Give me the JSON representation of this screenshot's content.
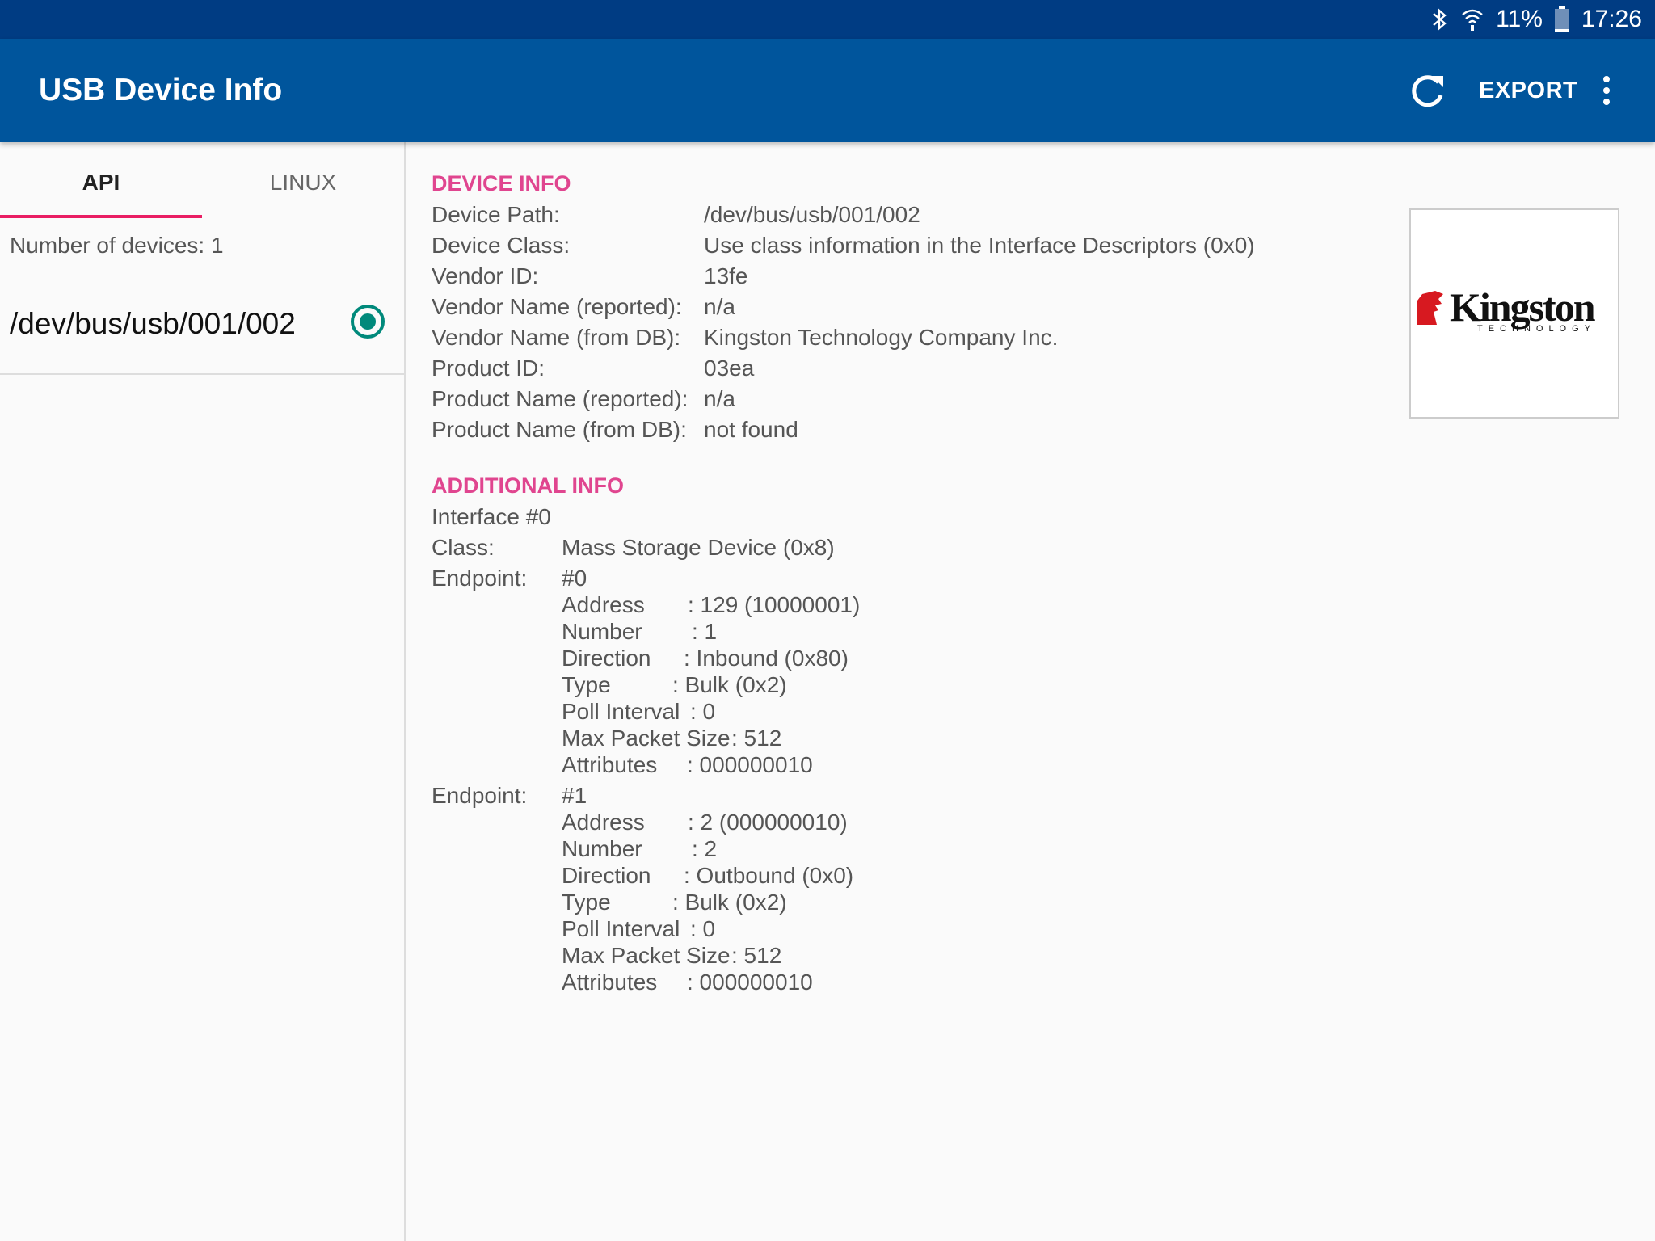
{
  "status_bar": {
    "battery_percent": "11%",
    "time": "17:26",
    "icons": [
      "bluetooth-icon",
      "wifi-icon",
      "battery-icon"
    ]
  },
  "app_bar": {
    "title": "USB Device Info",
    "export_label": "EXPORT",
    "icons": [
      "refresh-icon",
      "more-vert-icon"
    ]
  },
  "tabs": [
    {
      "label": "API",
      "selected": true
    },
    {
      "label": "LINUX",
      "selected": false
    }
  ],
  "device_list": {
    "count_text": "Number of devices: 1",
    "devices": [
      {
        "path": "/dev/bus/usb/001/002",
        "selected": true
      }
    ]
  },
  "device_info": {
    "header": "DEVICE INFO",
    "rows": [
      {
        "label": "Device Path:",
        "value": "/dev/bus/usb/001/002"
      },
      {
        "label": "Device Class:",
        "value": "Use class information in the Interface Descriptors (0x0)"
      },
      {
        "label": "Vendor ID:",
        "value": "13fe"
      },
      {
        "label": "Vendor Name (reported):",
        "value": "n/a"
      },
      {
        "label": "Vendor Name (from DB):",
        "value": "Kingston Technology Company Inc."
      },
      {
        "label": "Product ID:",
        "value": "03ea"
      },
      {
        "label": "Product Name (reported):",
        "value": "n/a"
      },
      {
        "label": "Product Name (from DB):",
        "value": "not found"
      }
    ]
  },
  "logo": {
    "brand": "Kingston",
    "sub": "TECHNOLOGY",
    "colors": {
      "red": "#d71920",
      "black": "#111111"
    }
  },
  "additional_info": {
    "header": "ADDITIONAL INFO",
    "interface": "Interface #0",
    "class_label": "Class:",
    "class_value": "Mass Storage Device (0x8)",
    "endpoints": [
      {
        "label": "Endpoint:",
        "id": "#0",
        "fields": [
          {
            "name": "Address",
            "value": ": 129 (10000001)"
          },
          {
            "name": "Number",
            "value": ": 1"
          },
          {
            "name": "Direction",
            "value": ": Inbound (0x80)"
          },
          {
            "name": "Type",
            "value": ": Bulk (0x2)"
          },
          {
            "name": "Poll Interval",
            "value": ": 0"
          },
          {
            "name": "Max Packet Size",
            "value": ": 512"
          },
          {
            "name": "Attributes",
            "value": ": 000000010"
          }
        ]
      },
      {
        "label": "Endpoint:",
        "id": "#1",
        "fields": [
          {
            "name": "Address",
            "value": ": 2 (000000010)"
          },
          {
            "name": "Number",
            "value": ": 2"
          },
          {
            "name": "Direction",
            "value": ": Outbound (0x0)"
          },
          {
            "name": "Type",
            "value": ": Bulk (0x2)"
          },
          {
            "name": "Poll Interval",
            "value": ": 0"
          },
          {
            "name": "Max Packet Size",
            "value": ": 512"
          },
          {
            "name": "Attributes",
            "value": ": 000000010"
          }
        ]
      }
    ]
  },
  "colors": {
    "status_bar": "#003c83",
    "app_bar": "#00559c",
    "accent": "#e91e63",
    "section_header": "#e0458f",
    "radio": "#00897b"
  }
}
